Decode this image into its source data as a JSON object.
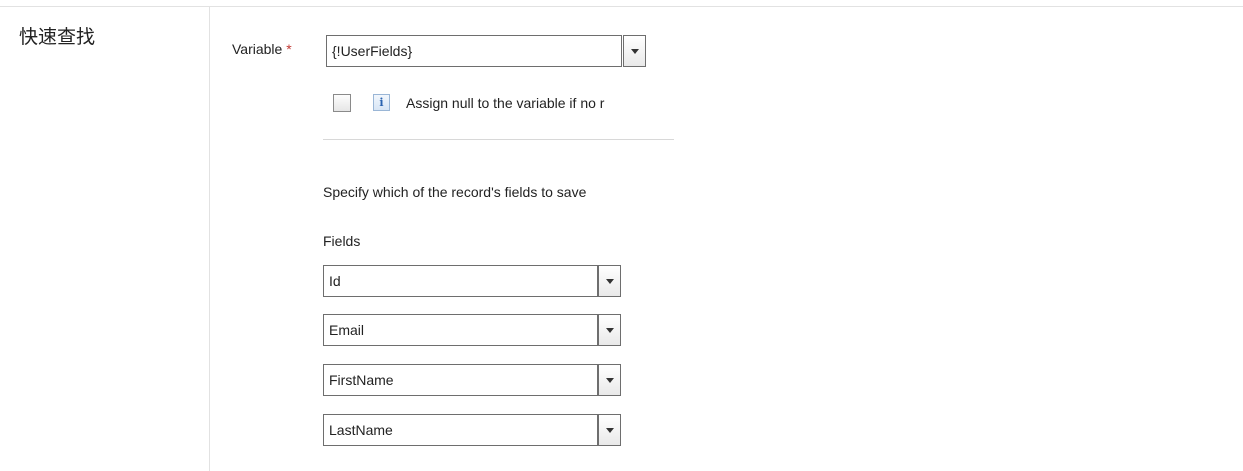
{
  "section_title": "快速查找",
  "variable": {
    "label": "Variable",
    "required_mark": "*",
    "value": "{!UserFields}"
  },
  "assign_null": {
    "checked": false,
    "text": "Assign null to the variable if no r"
  },
  "specify_text": "Specify which of the record's fields to save",
  "fields_label": "Fields",
  "fields": [
    "Id",
    "Email",
    "FirstName",
    "LastName"
  ],
  "icons": {
    "info": "info-icon",
    "dropdown": "chevron-down-icon"
  },
  "colors": {
    "required": "#c23934",
    "info_icon": "#2a63b0",
    "border": "#6e6e6e"
  }
}
